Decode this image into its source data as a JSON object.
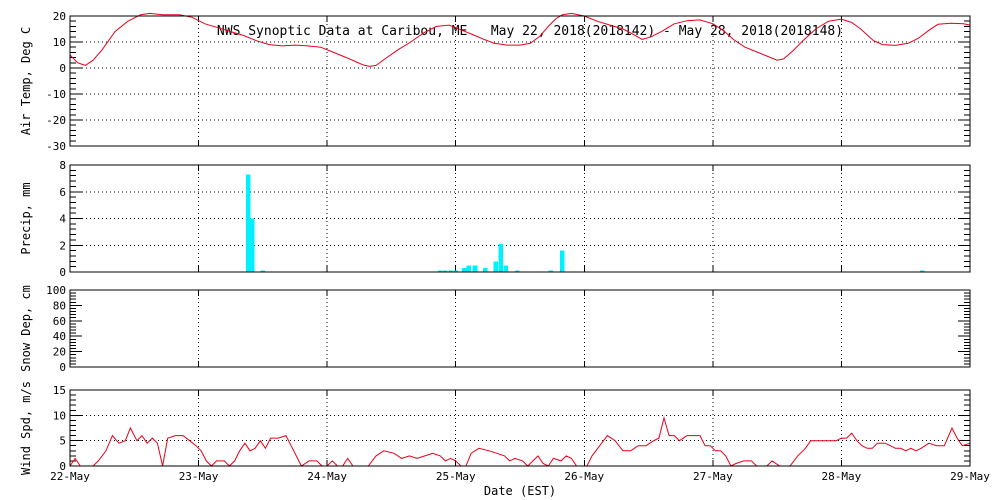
{
  "title": "NWS Synoptic Data at Caribou, ME   May 22, 2018(2018142) - May 28, 2018(2018148)",
  "x_axis": {
    "label": "Date (EST)",
    "tick_labels": [
      "22-May",
      "23-May",
      "24-May",
      "25-May",
      "26-May",
      "27-May",
      "28-May",
      "29-May"
    ]
  },
  "colors": {
    "line": "#e8001c",
    "bar": "#00f0ff",
    "grid": "#000000",
    "frame": "#000000"
  },
  "chart_data": [
    {
      "id": "air-temp",
      "type": "line",
      "ylabel": "Air Temp, Deg C",
      "ylim": [
        -30,
        20
      ],
      "yticks": [
        -30,
        -20,
        -10,
        0,
        10,
        20
      ],
      "xlim": [
        0,
        7
      ],
      "grid": true,
      "series": [
        {
          "points": [
            [
              0.0,
              5
            ],
            [
              0.06,
              2
            ],
            [
              0.12,
              1
            ],
            [
              0.18,
              3
            ],
            [
              0.25,
              7
            ],
            [
              0.35,
              14
            ],
            [
              0.45,
              18
            ],
            [
              0.55,
              20.5
            ],
            [
              0.62,
              21
            ],
            [
              0.72,
              20.5
            ],
            [
              0.85,
              20.5
            ],
            [
              0.95,
              19.5
            ],
            [
              1.05,
              17
            ],
            [
              1.15,
              15.5
            ],
            [
              1.25,
              14
            ],
            [
              1.35,
              12.5
            ],
            [
              1.45,
              10.5
            ],
            [
              1.55,
              9
            ],
            [
              1.65,
              8.5
            ],
            [
              1.75,
              8.8
            ],
            [
              1.85,
              8.5
            ],
            [
              1.95,
              8
            ],
            [
              2.05,
              6
            ],
            [
              2.15,
              4
            ],
            [
              2.22,
              2.5
            ],
            [
              2.28,
              1.2
            ],
            [
              2.33,
              0.6
            ],
            [
              2.38,
              1
            ],
            [
              2.45,
              3.5
            ],
            [
              2.55,
              7
            ],
            [
              2.65,
              10
            ],
            [
              2.75,
              13.5
            ],
            [
              2.85,
              16
            ],
            [
              2.95,
              16.5
            ],
            [
              3.05,
              14.5
            ],
            [
              3.15,
              12.5
            ],
            [
              3.22,
              11
            ],
            [
              3.3,
              9.5
            ],
            [
              3.4,
              8.8
            ],
            [
              3.5,
              8.8
            ],
            [
              3.58,
              9.5
            ],
            [
              3.65,
              12
            ],
            [
              3.72,
              16
            ],
            [
              3.78,
              19
            ],
            [
              3.83,
              20.5
            ],
            [
              3.9,
              21
            ],
            [
              4.0,
              20
            ],
            [
              4.1,
              18
            ],
            [
              4.2,
              16.5
            ],
            [
              4.3,
              15
            ],
            [
              4.38,
              13
            ],
            [
              4.45,
              11
            ],
            [
              4.52,
              12
            ],
            [
              4.6,
              14
            ],
            [
              4.7,
              17
            ],
            [
              4.8,
              18.2
            ],
            [
              4.9,
              18.5
            ],
            [
              5.0,
              17
            ],
            [
              5.08,
              14.5
            ],
            [
              5.16,
              11
            ],
            [
              5.25,
              8
            ],
            [
              5.35,
              6
            ],
            [
              5.45,
              4
            ],
            [
              5.5,
              3
            ],
            [
              5.55,
              3.5
            ],
            [
              5.62,
              6.5
            ],
            [
              5.7,
              10.5
            ],
            [
              5.8,
              15
            ],
            [
              5.9,
              18
            ],
            [
              6.0,
              18.8
            ],
            [
              6.08,
              17.5
            ],
            [
              6.15,
              15
            ],
            [
              6.25,
              10.5
            ],
            [
              6.32,
              9
            ],
            [
              6.42,
              8.7
            ],
            [
              6.52,
              9.5
            ],
            [
              6.6,
              11.5
            ],
            [
              6.68,
              14.5
            ],
            [
              6.75,
              16.8
            ],
            [
              6.85,
              17.2
            ],
            [
              6.95,
              17
            ],
            [
              7.0,
              16.5
            ]
          ]
        }
      ]
    },
    {
      "id": "precip",
      "type": "bar",
      "ylabel": "Precip, mm",
      "ylim": [
        0,
        8
      ],
      "yticks": [
        0,
        2,
        4,
        6,
        8
      ],
      "xlim": [
        0,
        7
      ],
      "grid": true,
      "bars": [
        {
          "x": 1.385,
          "value": 7.3
        },
        {
          "x": 1.417,
          "value": 4.0
        },
        {
          "x": 1.5,
          "value": 0.08
        },
        {
          "x": 2.88,
          "value": 0.05
        },
        {
          "x": 2.92,
          "value": 0.05
        },
        {
          "x": 2.96,
          "value": 0.05
        },
        {
          "x": 3.0,
          "value": 0.05
        },
        {
          "x": 3.065,
          "value": 0.3
        },
        {
          "x": 3.1,
          "value": 0.5
        },
        {
          "x": 3.15,
          "value": 0.5
        },
        {
          "x": 3.23,
          "value": 0.3
        },
        {
          "x": 3.31,
          "value": 0.8
        },
        {
          "x": 3.35,
          "value": 2.1
        },
        {
          "x": 3.39,
          "value": 0.5
        },
        {
          "x": 3.48,
          "value": 0.05
        },
        {
          "x": 3.74,
          "value": 0.05
        },
        {
          "x": 3.83,
          "value": 1.6
        },
        {
          "x": 6.63,
          "value": 0.05
        }
      ]
    },
    {
      "id": "snow-depth",
      "type": "line",
      "ylabel": "Snow Dep, cm",
      "ylim": [
        0,
        100
      ],
      "yticks": [
        0,
        20,
        40,
        60,
        80,
        100
      ],
      "xlim": [
        0,
        7
      ],
      "grid": false,
      "series": []
    },
    {
      "id": "wind-speed",
      "type": "line",
      "ylabel": "Wind Spd, m/s",
      "ylim": [
        0,
        15
      ],
      "yticks": [
        0,
        5,
        10,
        15
      ],
      "xlim": [
        0,
        7
      ],
      "grid": true,
      "series": [
        {
          "points": [
            [
              0.0,
              0
            ],
            [
              0.04,
              1.5
            ],
            [
              0.08,
              0
            ],
            [
              0.12,
              0
            ],
            [
              0.18,
              0
            ],
            [
              0.22,
              1
            ],
            [
              0.28,
              3
            ],
            [
              0.33,
              6
            ],
            [
              0.38,
              4.5
            ],
            [
              0.43,
              5
            ],
            [
              0.47,
              7.5
            ],
            [
              0.52,
              5
            ],
            [
              0.56,
              6
            ],
            [
              0.6,
              4.5
            ],
            [
              0.64,
              5.5
            ],
            [
              0.68,
              4.5
            ],
            [
              0.72,
              0
            ],
            [
              0.76,
              5.5
            ],
            [
              0.82,
              6
            ],
            [
              0.88,
              6
            ],
            [
              0.93,
              5
            ],
            [
              0.98,
              4
            ],
            [
              1.02,
              3
            ],
            [
              1.06,
              1
            ],
            [
              1.1,
              0
            ],
            [
              1.14,
              1
            ],
            [
              1.2,
              1
            ],
            [
              1.24,
              0
            ],
            [
              1.28,
              1
            ],
            [
              1.32,
              3
            ],
            [
              1.36,
              4.5
            ],
            [
              1.4,
              3
            ],
            [
              1.44,
              3.5
            ],
            [
              1.48,
              5
            ],
            [
              1.52,
              3.5
            ],
            [
              1.56,
              5.5
            ],
            [
              1.62,
              5.5
            ],
            [
              1.68,
              6
            ],
            [
              1.72,
              4
            ],
            [
              1.76,
              2
            ],
            [
              1.8,
              0
            ],
            [
              1.86,
              1
            ],
            [
              1.92,
              1
            ],
            [
              1.96,
              0
            ],
            [
              2.0,
              0
            ],
            [
              2.04,
              1
            ],
            [
              2.08,
              0
            ],
            [
              2.12,
              0
            ],
            [
              2.16,
              1.5
            ],
            [
              2.2,
              0
            ],
            [
              2.26,
              0
            ],
            [
              2.32,
              0
            ],
            [
              2.38,
              2
            ],
            [
              2.44,
              3
            ],
            [
              2.52,
              2.5
            ],
            [
              2.58,
              1.5
            ],
            [
              2.64,
              2
            ],
            [
              2.7,
              1.5
            ],
            [
              2.76,
              2
            ],
            [
              2.82,
              2.5
            ],
            [
              2.88,
              2
            ],
            [
              2.92,
              1
            ],
            [
              2.96,
              1.5
            ],
            [
              3.0,
              1
            ],
            [
              3.04,
              0
            ],
            [
              3.08,
              0
            ],
            [
              3.12,
              2.5
            ],
            [
              3.18,
              3.5
            ],
            [
              3.26,
              3
            ],
            [
              3.32,
              2.5
            ],
            [
              3.38,
              2
            ],
            [
              3.42,
              1
            ],
            [
              3.46,
              1.5
            ],
            [
              3.52,
              1
            ],
            [
              3.56,
              0
            ],
            [
              3.6,
              1
            ],
            [
              3.64,
              2
            ],
            [
              3.68,
              0.5
            ],
            [
              3.72,
              0
            ],
            [
              3.76,
              1.5
            ],
            [
              3.82,
              1
            ],
            [
              3.86,
              2
            ],
            [
              3.9,
              1.5
            ],
            [
              3.94,
              0
            ],
            [
              4.02,
              0
            ],
            [
              4.06,
              2
            ],
            [
              4.12,
              4
            ],
            [
              4.18,
              6
            ],
            [
              4.24,
              5
            ],
            [
              4.3,
              3
            ],
            [
              4.36,
              3
            ],
            [
              4.42,
              4
            ],
            [
              4.48,
              4
            ],
            [
              4.54,
              5
            ],
            [
              4.58,
              5.5
            ],
            [
              4.62,
              9.5
            ],
            [
              4.66,
              6
            ],
            [
              4.7,
              6
            ],
            [
              4.74,
              5
            ],
            [
              4.8,
              6
            ],
            [
              4.86,
              6
            ],
            [
              4.9,
              6
            ],
            [
              4.94,
              4
            ],
            [
              4.98,
              4
            ],
            [
              5.02,
              3
            ],
            [
              5.06,
              3
            ],
            [
              5.1,
              2
            ],
            [
              5.14,
              0
            ],
            [
              5.18,
              0.5
            ],
            [
              5.24,
              1
            ],
            [
              5.3,
              1
            ],
            [
              5.34,
              0
            ],
            [
              5.38,
              0
            ],
            [
              5.42,
              0
            ],
            [
              5.46,
              1
            ],
            [
              5.52,
              0
            ],
            [
              5.6,
              0
            ],
            [
              5.66,
              2
            ],
            [
              5.72,
              3.5
            ],
            [
              5.76,
              5
            ],
            [
              5.84,
              5
            ],
            [
              5.9,
              5
            ],
            [
              5.96,
              5
            ],
            [
              6.0,
              5.5
            ],
            [
              6.04,
              5.5
            ],
            [
              6.08,
              6.5
            ],
            [
              6.12,
              5
            ],
            [
              6.16,
              4
            ],
            [
              6.2,
              3.5
            ],
            [
              6.24,
              3.5
            ],
            [
              6.28,
              4.5
            ],
            [
              6.34,
              4.5
            ],
            [
              6.38,
              4
            ],
            [
              6.42,
              3.5
            ],
            [
              6.46,
              3.5
            ],
            [
              6.5,
              3
            ],
            [
              6.54,
              3.5
            ],
            [
              6.58,
              3
            ],
            [
              6.62,
              3.5
            ],
            [
              6.68,
              4.5
            ],
            [
              6.74,
              4
            ],
            [
              6.8,
              4
            ],
            [
              6.86,
              7.5
            ],
            [
              6.9,
              5.5
            ],
            [
              6.94,
              4
            ],
            [
              7.0,
              4.5
            ]
          ]
        }
      ]
    }
  ]
}
